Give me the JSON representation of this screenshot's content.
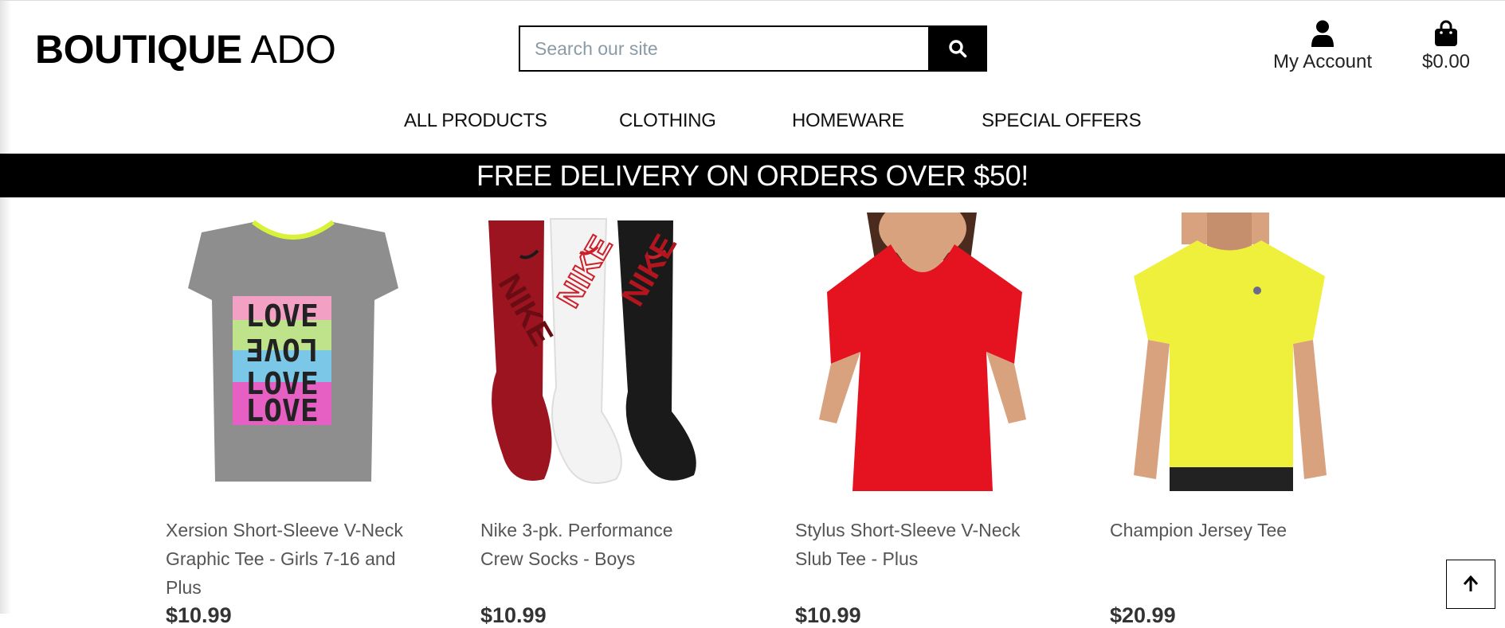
{
  "header": {
    "logo_strong": "BOUTIQUE",
    "logo_light": "ADO",
    "search": {
      "placeholder": "Search our site",
      "value": "",
      "button_icon": "search-icon"
    },
    "account": {
      "icon": "user-icon",
      "label": "My Account"
    },
    "bag": {
      "icon": "shopping-bag-icon",
      "total": "$0.00"
    }
  },
  "nav": {
    "items": [
      {
        "label": "ALL PRODUCTS"
      },
      {
        "label": "CLOTHING"
      },
      {
        "label": "HOMEWARE"
      },
      {
        "label": "SPECIAL OFFERS"
      }
    ]
  },
  "banner": {
    "text": "FREE DELIVERY ON ORDERS OVER $50!"
  },
  "products": [
    {
      "name": "Xersion Short-Sleeve V-Neck Graphic Tee - Girls 7-16 and Plus",
      "price": "$10.99",
      "image": "grey-love-graphic-tee"
    },
    {
      "name": "Nike 3-pk. Performance Crew Socks - Boys",
      "price": "$10.99",
      "image": "red-white-black-nike-socks"
    },
    {
      "name": "Stylus Short-Sleeve V-Neck Slub Tee - Plus",
      "price": "$10.99",
      "image": "red-v-neck-tee"
    },
    {
      "name": "Champion Jersey Tee",
      "price": "$20.99",
      "image": "yellow-jersey-tee"
    }
  ],
  "back_to_top": {
    "icon": "arrow-up-icon"
  },
  "colors": {
    "banner_bg": "#000000",
    "banner_text": "#ffffff",
    "search_button": "#000000",
    "product_text": "#555555"
  }
}
